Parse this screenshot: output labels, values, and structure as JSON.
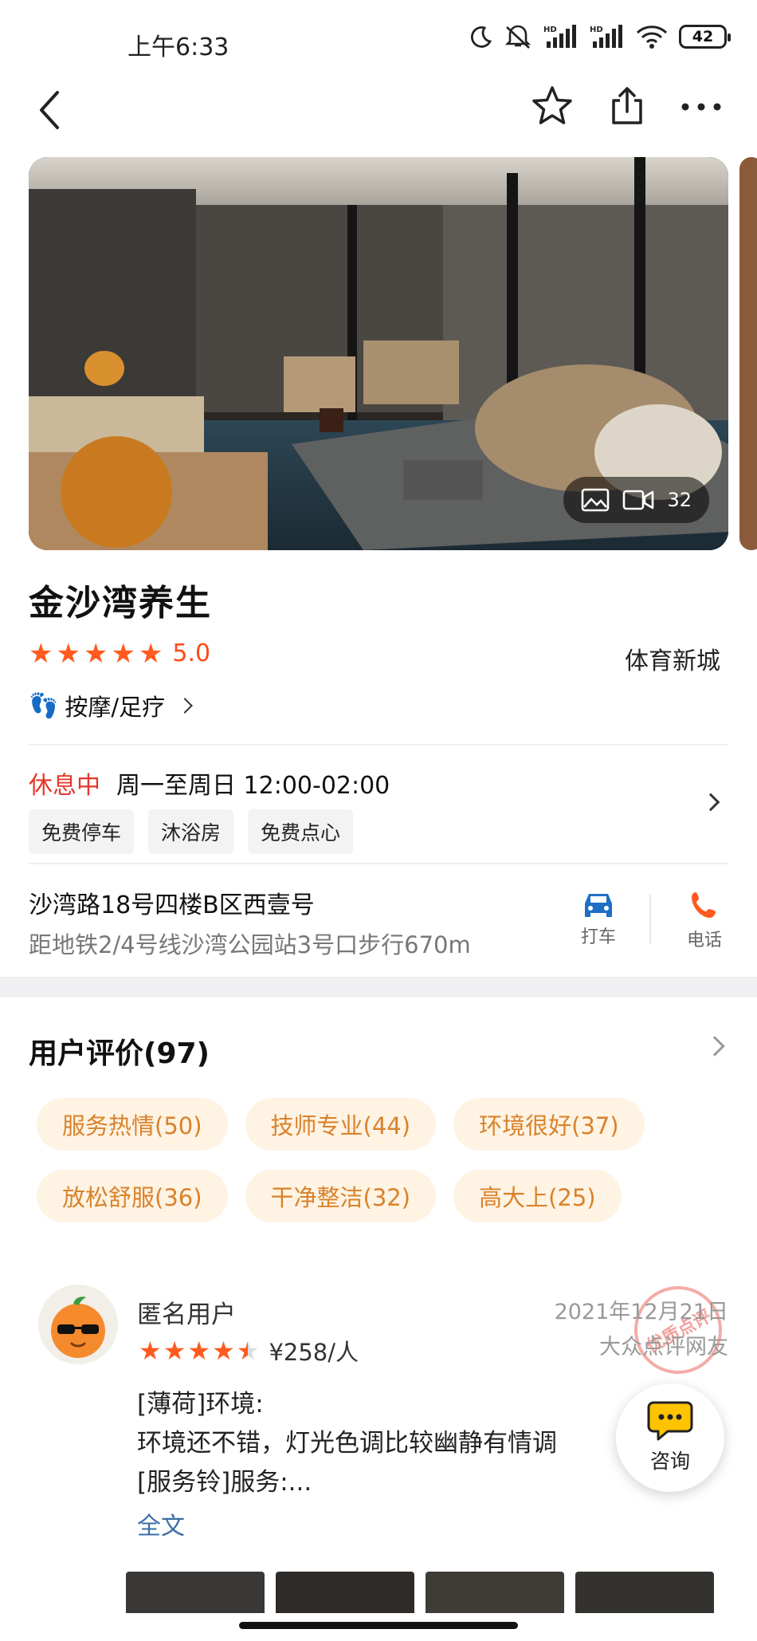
{
  "status_bar": {
    "time": "上午6:33",
    "battery": "42"
  },
  "shop": {
    "name": "金沙湾养生",
    "rating": "5.0",
    "district": "体育新城",
    "category": "按摩/足疗",
    "media_count": "32",
    "hours_status": "休息中",
    "hours": "周一至周日 12:00-02:00",
    "tags": [
      "免费停车",
      "沐浴房",
      "免费点心"
    ],
    "address": "沙湾路18号四楼B区西壹号",
    "metro": "距地铁2/4号线沙湾公园站3号口步行670m",
    "actions": {
      "taxi": "打车",
      "phone": "电话"
    }
  },
  "reviews": {
    "title": "用户评价(97)",
    "chips": [
      "服务热情(50)",
      "技师专业(44)",
      "环境很好(37)",
      "放松舒服(36)",
      "干净整洁(32)",
      "高大上(25)"
    ],
    "item": {
      "user": "匿名用户",
      "date": "2021年12月21日",
      "source": "大众点评网友",
      "stamp": "优质点评",
      "stars": 4.5,
      "price": "¥258/人",
      "lines": [
        "[薄荷]环境:",
        "环境还不错，灯光色调比较幽静有情调",
        "[服务铃]服务:..."
      ],
      "more": "全文"
    }
  },
  "consult": {
    "label": "咨询"
  },
  "colors": {
    "accent": "#ff5a1f",
    "closed": "#e5372b",
    "chip_text": "#d9822b",
    "chip_bg": "#fff3e3",
    "link": "#3c6ea6",
    "taxi": "#1f6fc5",
    "phone": "#ff5a1f"
  }
}
